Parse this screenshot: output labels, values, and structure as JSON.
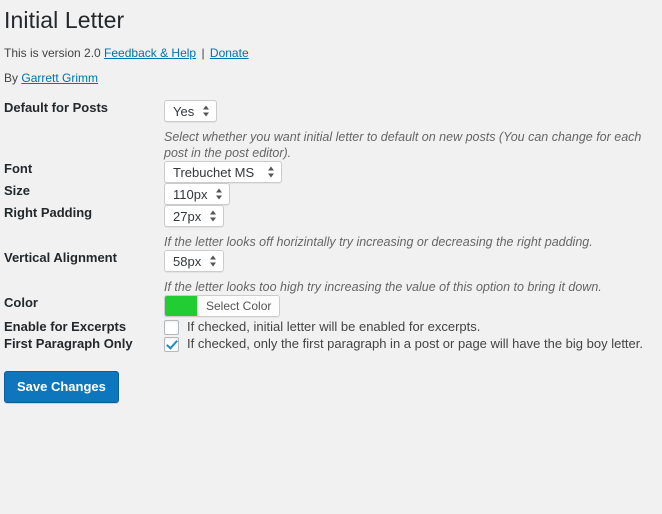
{
  "header": {
    "title": "Initial Letter",
    "version_prefix": "This is version 2.0",
    "feedback_link": "Feedback & Help",
    "separator": "|",
    "donate_link": "Donate",
    "by_prefix": "By",
    "author_link": "Garrett Grimm"
  },
  "fields": {
    "default_for_posts": {
      "label": "Default for Posts",
      "value": "Yes",
      "description": "Select whether you want initial letter to default on new posts (You can change for each post in the post editor)."
    },
    "font": {
      "label": "Font",
      "value": "Trebuchet MS"
    },
    "size": {
      "label": "Size",
      "value": "110px"
    },
    "right_padding": {
      "label": "Right Padding",
      "value": "27px",
      "description": "If the letter looks off horizintally try increasing or decreasing the right padding."
    },
    "vertical_alignment": {
      "label": "Vertical Alignment",
      "value": "58px",
      "description": "If the letter looks too high try increasing the value of this option to bring it down."
    },
    "color": {
      "label": "Color",
      "button_label": "Select Color",
      "swatch_hex": "#22cc33"
    },
    "enable_for_excerpts": {
      "label": "Enable for Excerpts",
      "checkbox_text": "If checked, initial letter will be enabled for excerpts.",
      "checked": false
    },
    "first_paragraph_only": {
      "label": "First Paragraph Only",
      "checkbox_text": "If checked, only the first paragraph in a post or page will have the big boy letter.",
      "checked": true
    }
  },
  "submit": {
    "save_label": "Save Changes"
  },
  "colors": {
    "accent": "#0073aa",
    "button": "#0e76bc",
    "page_bg": "#f1f1f1",
    "swatch": "#22cc33"
  }
}
